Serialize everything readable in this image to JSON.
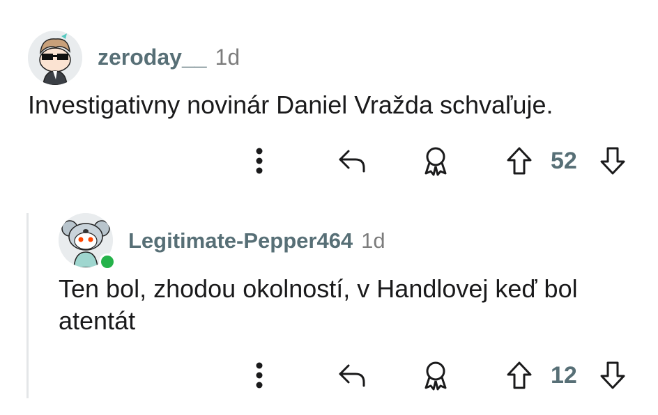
{
  "comments": [
    {
      "username": "zeroday__",
      "time": "1d",
      "text": "Investigativny novinár Daniel Vražda schvaľuje.",
      "score": "52"
    },
    {
      "username": "Legitimate-Pepper464",
      "time": "1d",
      "text_line1": "Ten bol, zhodou okolností, v Handlovej keď bol",
      "text_line2": "atentát",
      "score": "12",
      "online": true
    }
  ],
  "colors": {
    "online": "#25b24a",
    "meta": "#576f76",
    "text": "#1a1a1b"
  },
  "icons": [
    "more-icon",
    "reply-icon",
    "award-icon",
    "upvote-icon",
    "downvote-icon"
  ]
}
